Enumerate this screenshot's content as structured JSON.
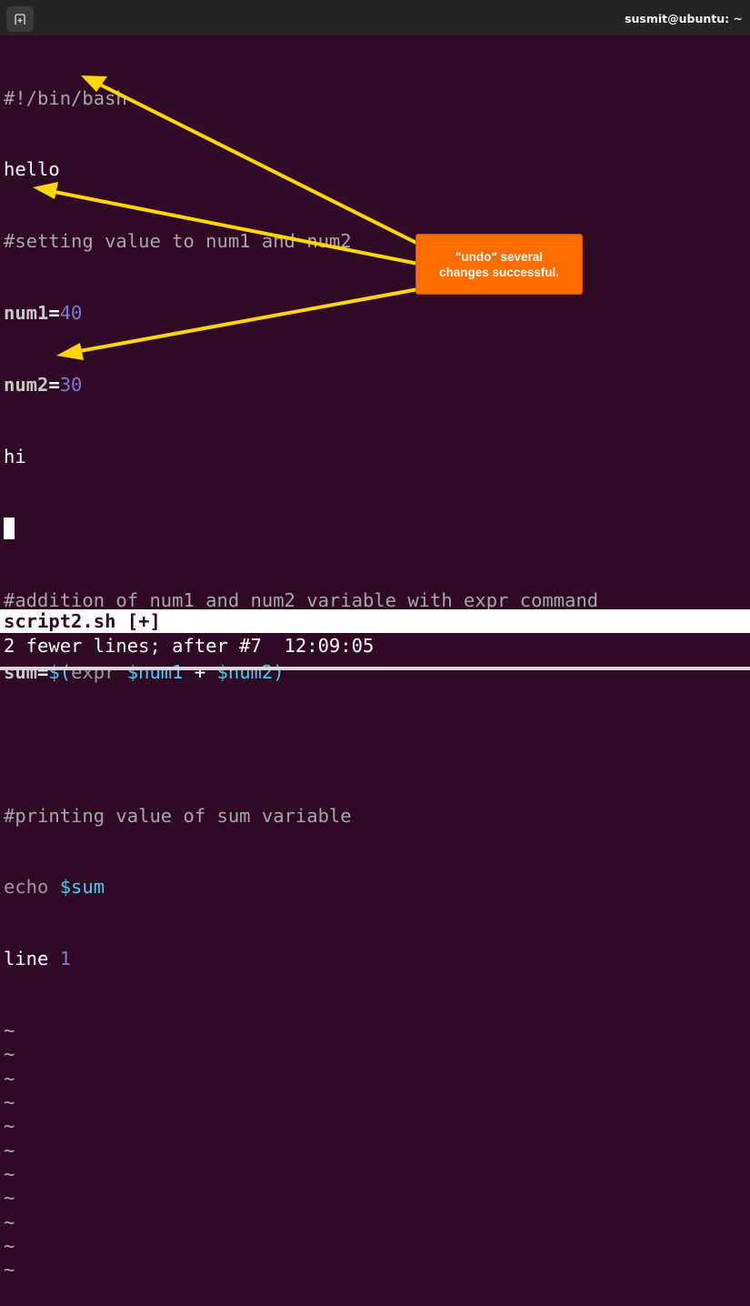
{
  "window": {
    "title": "susmit@ubuntu: ~",
    "new_tab_icon": "new-tab-icon"
  },
  "editor": {
    "lines": {
      "shebang": "#!/bin/bash",
      "hello": "hello",
      "comment1": "#setting value to num1 and num2",
      "num1_name": "num1",
      "num1_eq": "=",
      "num1_val": "40",
      "num2_name": "num2",
      "num2_eq": "=",
      "num2_val": "30",
      "hi": "hi",
      "comment2": "#addition of num1 and num2 variable with expr command",
      "sum_name": "sum",
      "sum_eq": "=",
      "sum_open": "$(",
      "sum_expr": "expr ",
      "sum_var1": "$num1",
      "sum_plus": " + ",
      "sum_var2": "$num2",
      "sum_close": ")",
      "comment3": "#printing value of sum variable",
      "echo_cmd": "echo ",
      "echo_var": "$sum",
      "line_word": "line ",
      "line_num": "1"
    },
    "tilde": "~",
    "tilde_count": 11
  },
  "statusline": {
    "filename": "script2.sh [+]"
  },
  "message": "2 fewer lines; after #7  12:09:05",
  "annotation": {
    "text_line1": "\"undo\" several",
    "text_line2": "changes successful.",
    "box_color": "#ff6d00",
    "arrow_color": "#ffd700"
  }
}
